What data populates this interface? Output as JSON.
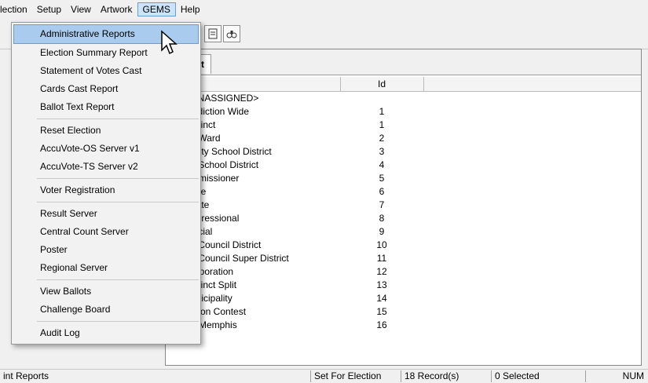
{
  "menubar": [
    "lection",
    "Setup",
    "View",
    "Artwork",
    "GEMS",
    "Help"
  ],
  "toolbar": {
    "icons": [
      "page-icon",
      "binoculars-icon"
    ]
  },
  "panel": {
    "tab": "ict",
    "columns": {
      "name": "",
      "id": "Id"
    },
    "rows": [
      {
        "name": "UNASSIGNED>",
        "id": ""
      },
      {
        "name": "isdiction Wide",
        "id": "1"
      },
      {
        "name": "ecinct",
        "id": "1"
      },
      {
        "name": "y Ward",
        "id": "2"
      },
      {
        "name": "unty School District",
        "id": "3"
      },
      {
        "name": "y School District",
        "id": "4"
      },
      {
        "name": "mmissioner",
        "id": "5"
      },
      {
        "name": "use",
        "id": "6"
      },
      {
        "name": "nate",
        "id": "7"
      },
      {
        "name": "ngressional",
        "id": "8"
      },
      {
        "name": "dicial",
        "id": "9"
      },
      {
        "name": "y Council District",
        "id": "10"
      },
      {
        "name": "y Council Super District",
        "id": "11"
      },
      {
        "name": "orporation",
        "id": "12"
      },
      {
        "name": "ecinct Split",
        "id": "13"
      },
      {
        "name": "unicipality",
        "id": "14"
      },
      {
        "name": "ction Contest",
        "id": "15"
      },
      {
        "name": "n Memphis",
        "id": "16"
      }
    ]
  },
  "gems_menu": {
    "groups": [
      [
        "Administrative Reports",
        "Election Summary Report",
        "Statement of Votes Cast",
        "Cards Cast Report",
        "Ballot Text Report"
      ],
      [
        "Reset Election",
        "AccuVote-OS Server v1",
        "AccuVote-TS Server v2"
      ],
      [
        "Voter Registration"
      ],
      [
        "Result Server",
        "Central Count Server",
        "Poster",
        "Regional Server"
      ],
      [
        "View Ballots",
        "Challenge Board"
      ],
      [
        "Audit Log"
      ]
    ],
    "highlighted": "Administrative Reports"
  },
  "statusbar": {
    "left": "int Reports",
    "mode": "Set For Election",
    "records": "18 Record(s)",
    "selected": "0 Selected",
    "num": "NUM"
  },
  "colors": {
    "highlight": "#a8cbee",
    "active_menu": "#cce4f7"
  }
}
